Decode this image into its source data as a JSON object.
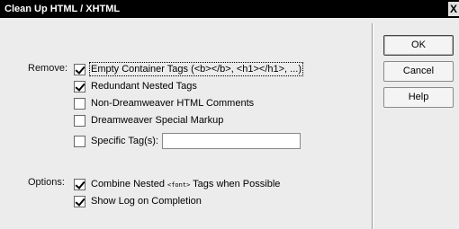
{
  "window": {
    "title": "Clean Up HTML / XHTML",
    "close_glyph": "X"
  },
  "remove": {
    "label": "Remove:",
    "items": [
      {
        "label": "Empty Container Tags (<b></b>, <h1></h1>, ...)",
        "checked": true
      },
      {
        "label": "Redundant Nested Tags",
        "checked": true
      },
      {
        "label": "Non-Dreamweaver HTML Comments",
        "checked": false
      },
      {
        "label": "Dreamweaver Special Markup",
        "checked": false
      }
    ],
    "specific": {
      "label": "Specific Tag(s):",
      "checked": false,
      "value": ""
    }
  },
  "options": {
    "label": "Options:",
    "combine": {
      "prefix": "Combine Nested ",
      "tag": "<font>",
      "suffix": " Tags when Possible",
      "checked": true
    },
    "show_log": {
      "label": "Show Log on Completion",
      "checked": true
    }
  },
  "buttons": {
    "ok": "OK",
    "cancel": "Cancel",
    "help": "Help"
  }
}
